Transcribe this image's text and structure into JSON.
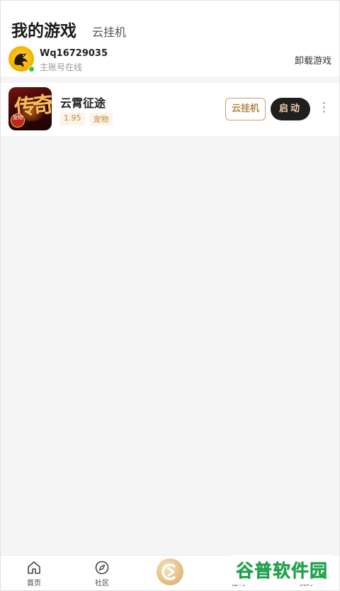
{
  "header": {
    "tab_my_games": "我的游戏",
    "tab_cloud_hosting": "云挂机"
  },
  "account": {
    "username": "Wq16729035",
    "status": "主账号在线",
    "uninstall_label": "卸载游戏",
    "online_color": "#2ecc40"
  },
  "games": [
    {
      "name": "云霄征途",
      "icon": "game-art-icon",
      "icon_text": "传奇",
      "icon_badge": "宠物",
      "tags": [
        "1.95",
        "宠物"
      ],
      "cloud_button": "云挂机",
      "launch_button": "启动"
    }
  ],
  "bottom_nav": {
    "items": [
      {
        "label": "首页",
        "icon": "home-icon"
      },
      {
        "label": "社区",
        "icon": "compass-icon"
      },
      {
        "label": "",
        "icon": "center-logo-icon"
      },
      {
        "label": "福利",
        "icon": "gift-icon"
      },
      {
        "label": "我的",
        "icon": "user-icon"
      }
    ]
  },
  "watermark": "谷普软件园",
  "colors": {
    "accent_gold": "#c9a06b",
    "launch_bg": "#1f1f1f",
    "watermark_green": "#1aa34a"
  }
}
